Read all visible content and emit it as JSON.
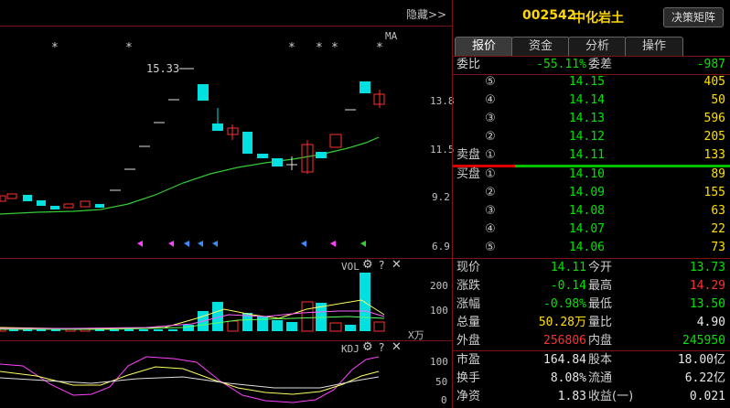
{
  "chart": {
    "hide_label": "隐藏>>",
    "ma_label": "MA",
    "price_ticks": [
      "13.8",
      "11.5",
      "9.2",
      "6.9"
    ],
    "high_marker": "15.33",
    "vol_label": "VOL",
    "vol_ticks": [
      "200",
      "100"
    ],
    "vol_unit": "X万",
    "kdj_label": "KDJ",
    "kdj_ticks": [
      "100",
      "50",
      "0"
    ],
    "colors": {
      "up": "#ff3030",
      "down": "#00e0e0",
      "ma": "#33cc33",
      "panel_border": "#7a1414"
    }
  },
  "quote": {
    "code": "002542",
    "name": "中化岩土",
    "decision_button": "决策矩阵",
    "tabs": [
      "报价",
      "资金",
      "分析",
      "操作"
    ],
    "active_tab": "报价",
    "weibi_label": "委比",
    "weibi_value": "-55.11%",
    "weicha_label": "委差",
    "weicha_value": "-987",
    "sell_label": "卖盘",
    "buy_label": "买盘",
    "sell_orders": [
      {
        "level": "⑤",
        "price": "14.15",
        "vol": "405"
      },
      {
        "level": "④",
        "price": "14.14",
        "vol": "50"
      },
      {
        "level": "③",
        "price": "14.13",
        "vol": "596"
      },
      {
        "level": "②",
        "price": "14.12",
        "vol": "205"
      },
      {
        "level": "①",
        "price": "14.11",
        "vol": "133"
      }
    ],
    "buy_orders": [
      {
        "level": "①",
        "price": "14.10",
        "vol": "89"
      },
      {
        "level": "②",
        "price": "14.09",
        "vol": "155"
      },
      {
        "level": "③",
        "price": "14.08",
        "vol": "63"
      },
      {
        "level": "④",
        "price": "14.07",
        "vol": "22"
      },
      {
        "level": "⑤",
        "price": "14.06",
        "vol": "73"
      }
    ],
    "stats": [
      {
        "l1": "现价",
        "v1": "14.11",
        "c1": "green",
        "l2": "今开",
        "v2": "13.73",
        "c2": "green"
      },
      {
        "l1": "涨跌",
        "v1": "-0.14",
        "c1": "green",
        "l2": "最高",
        "v2": "14.29",
        "c2": "red"
      },
      {
        "l1": "涨幅",
        "v1": "-0.98%",
        "c1": "green",
        "l2": "最低",
        "v2": "13.50",
        "c2": "green"
      },
      {
        "l1": "总量",
        "v1": "50.28万",
        "c1": "yellow",
        "l2": "量比",
        "v2": "4.90",
        "c2": "white"
      },
      {
        "l1": "外盘",
        "v1": "256806",
        "c1": "red",
        "l2": "内盘",
        "v2": "245950",
        "c2": "green"
      }
    ],
    "stats2": [
      {
        "l1": "市盈",
        "v1": "164.84",
        "l2": "股本",
        "v2": "18.00亿"
      },
      {
        "l1": "换手",
        "v1": "8.08%",
        "l2": "流通",
        "v2": "6.22亿"
      },
      {
        "l1": "净资",
        "v1": "1.83",
        "l2": "收益(一)",
        "v2": "0.021"
      }
    ]
  }
}
